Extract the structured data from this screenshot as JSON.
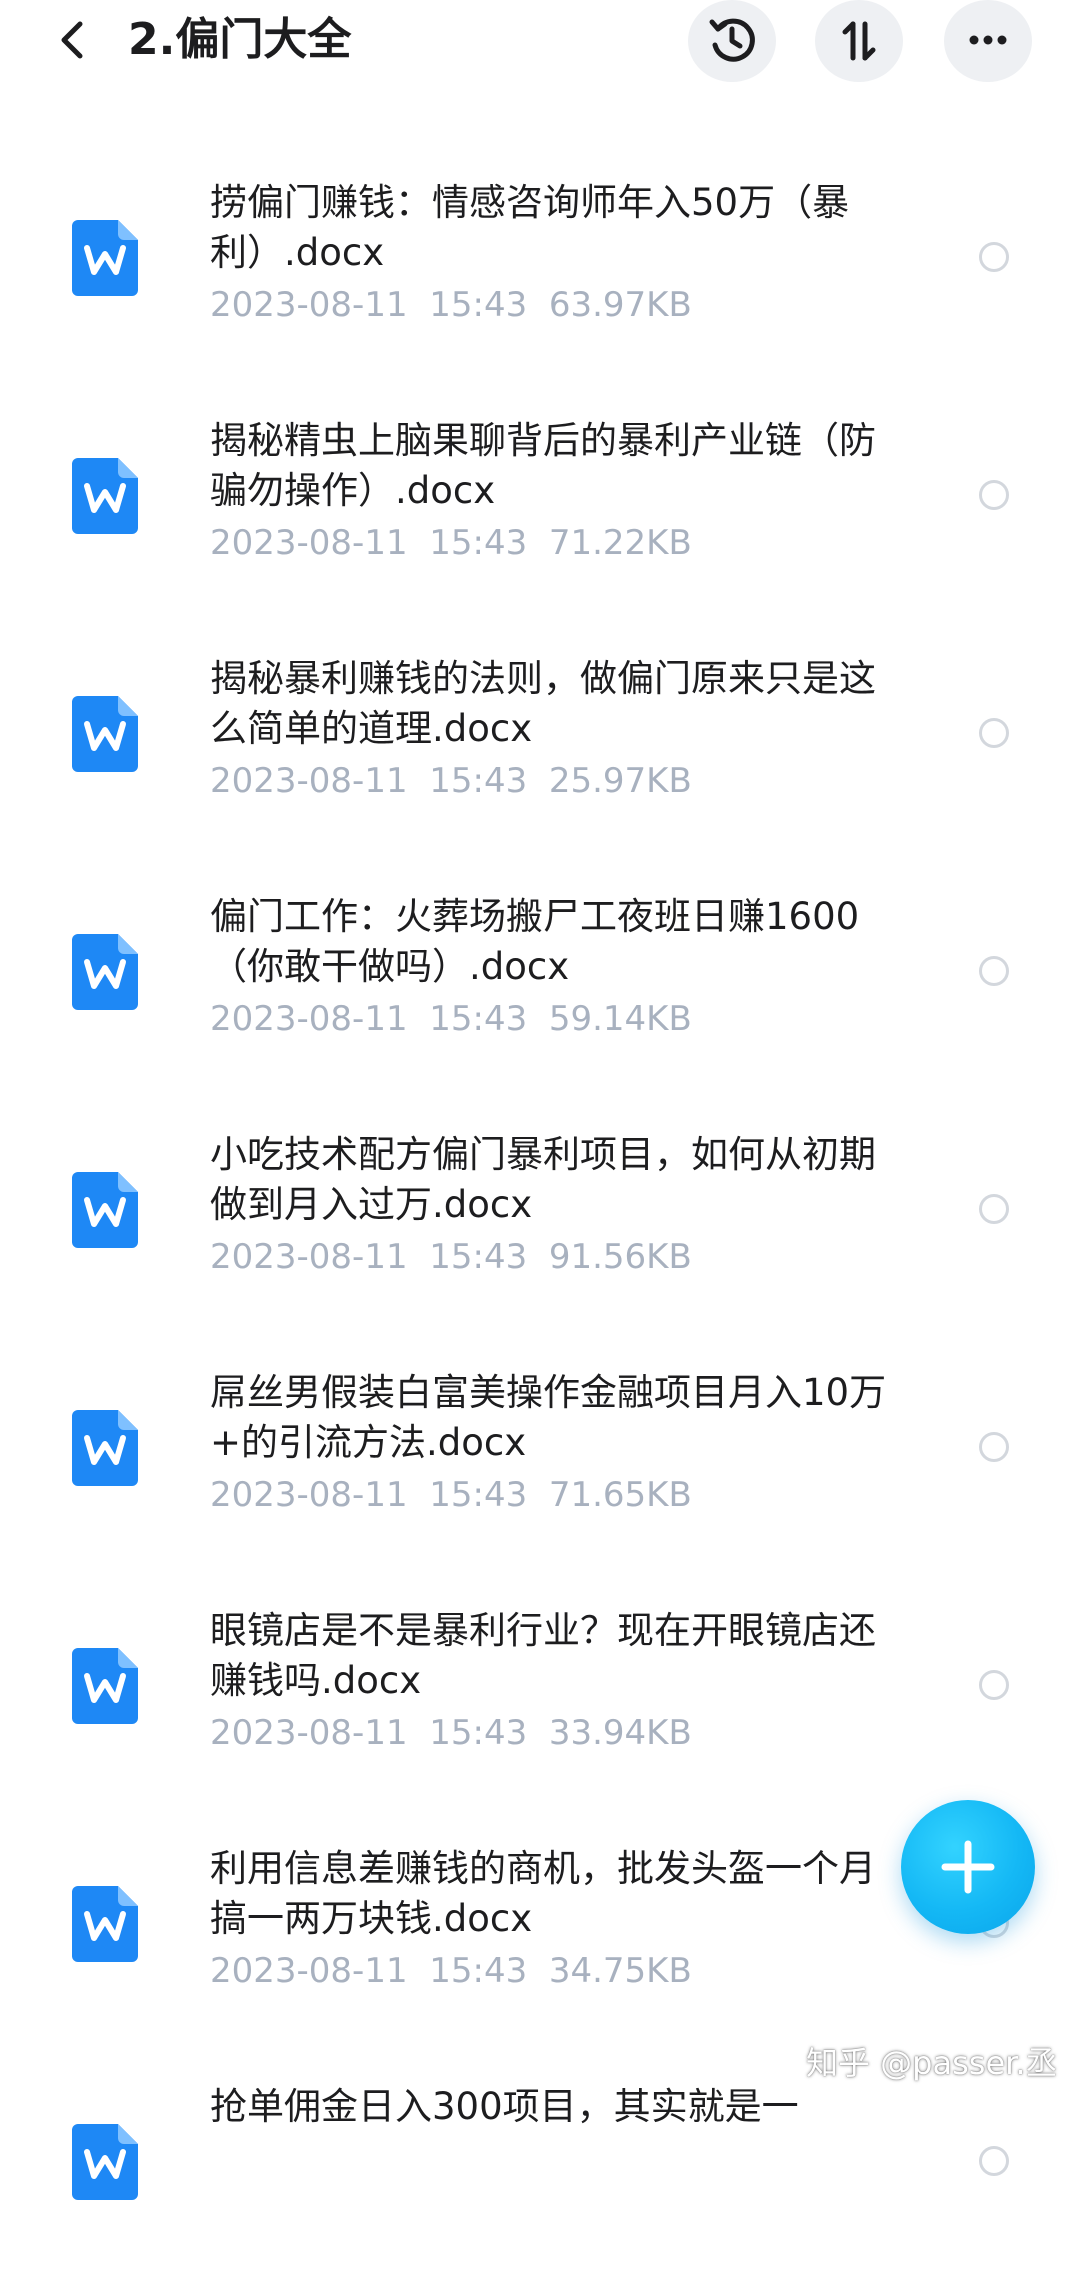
{
  "header": {
    "title": "2.偏门大全",
    "back_icon": "back-arrow-icon",
    "history_icon": "history-clock-icon",
    "sort_icon": "sort-icon",
    "more_icon": "more-dots-icon"
  },
  "files": [
    {
      "name": "捞偏门赚钱：情感咨询师年入50万（暴利）.docx",
      "date": "2023-08-11",
      "time": "15:43",
      "size": "63.97KB",
      "icon": "word-doc-icon"
    },
    {
      "name": "揭秘精虫上脑果聊背后的暴利产业链（防骗勿操作）.docx",
      "date": "2023-08-11",
      "time": "15:43",
      "size": "71.22KB",
      "icon": "word-doc-icon"
    },
    {
      "name": "揭秘暴利赚钱的法则，做偏门原来只是这么简单的道理.docx",
      "date": "2023-08-11",
      "time": "15:43",
      "size": "25.97KB",
      "icon": "word-doc-icon"
    },
    {
      "name": "偏门工作：火葬场搬尸工夜班日赚1600（你敢干做吗）.docx",
      "date": "2023-08-11",
      "time": "15:43",
      "size": "59.14KB",
      "icon": "word-doc-icon"
    },
    {
      "name": "小吃技术配方偏门暴利项目，如何从初期做到月入过万.docx",
      "date": "2023-08-11",
      "time": "15:43",
      "size": "91.56KB",
      "icon": "word-doc-icon"
    },
    {
      "name": "屌丝男假装白富美操作金融项目月入10万+的引流方法.docx",
      "date": "2023-08-11",
      "time": "15:43",
      "size": "71.65KB",
      "icon": "word-doc-icon"
    },
    {
      "name": "眼镜店是不是暴利行业？现在开眼镜店还赚钱吗.docx",
      "date": "2023-08-11",
      "time": "15:43",
      "size": "33.94KB",
      "icon": "word-doc-icon"
    },
    {
      "name": "利用信息差赚钱的商机，批发头盔一个月搞一两万块钱.docx",
      "date": "2023-08-11",
      "time": "15:43",
      "size": "34.75KB",
      "icon": "word-doc-icon"
    },
    {
      "name": "抢单佣金日入300项目，其实就是一",
      "date": "",
      "time": "",
      "size": "",
      "icon": "word-doc-icon"
    }
  ],
  "fab": {
    "icon": "plus-icon"
  },
  "watermark": {
    "text": "知乎 @passer.丞"
  },
  "colors": {
    "accent": "#1e88f5",
    "fab": "#14b8f5",
    "meta_text": "#a8b1bf",
    "button_bg": "#eef0f3"
  }
}
